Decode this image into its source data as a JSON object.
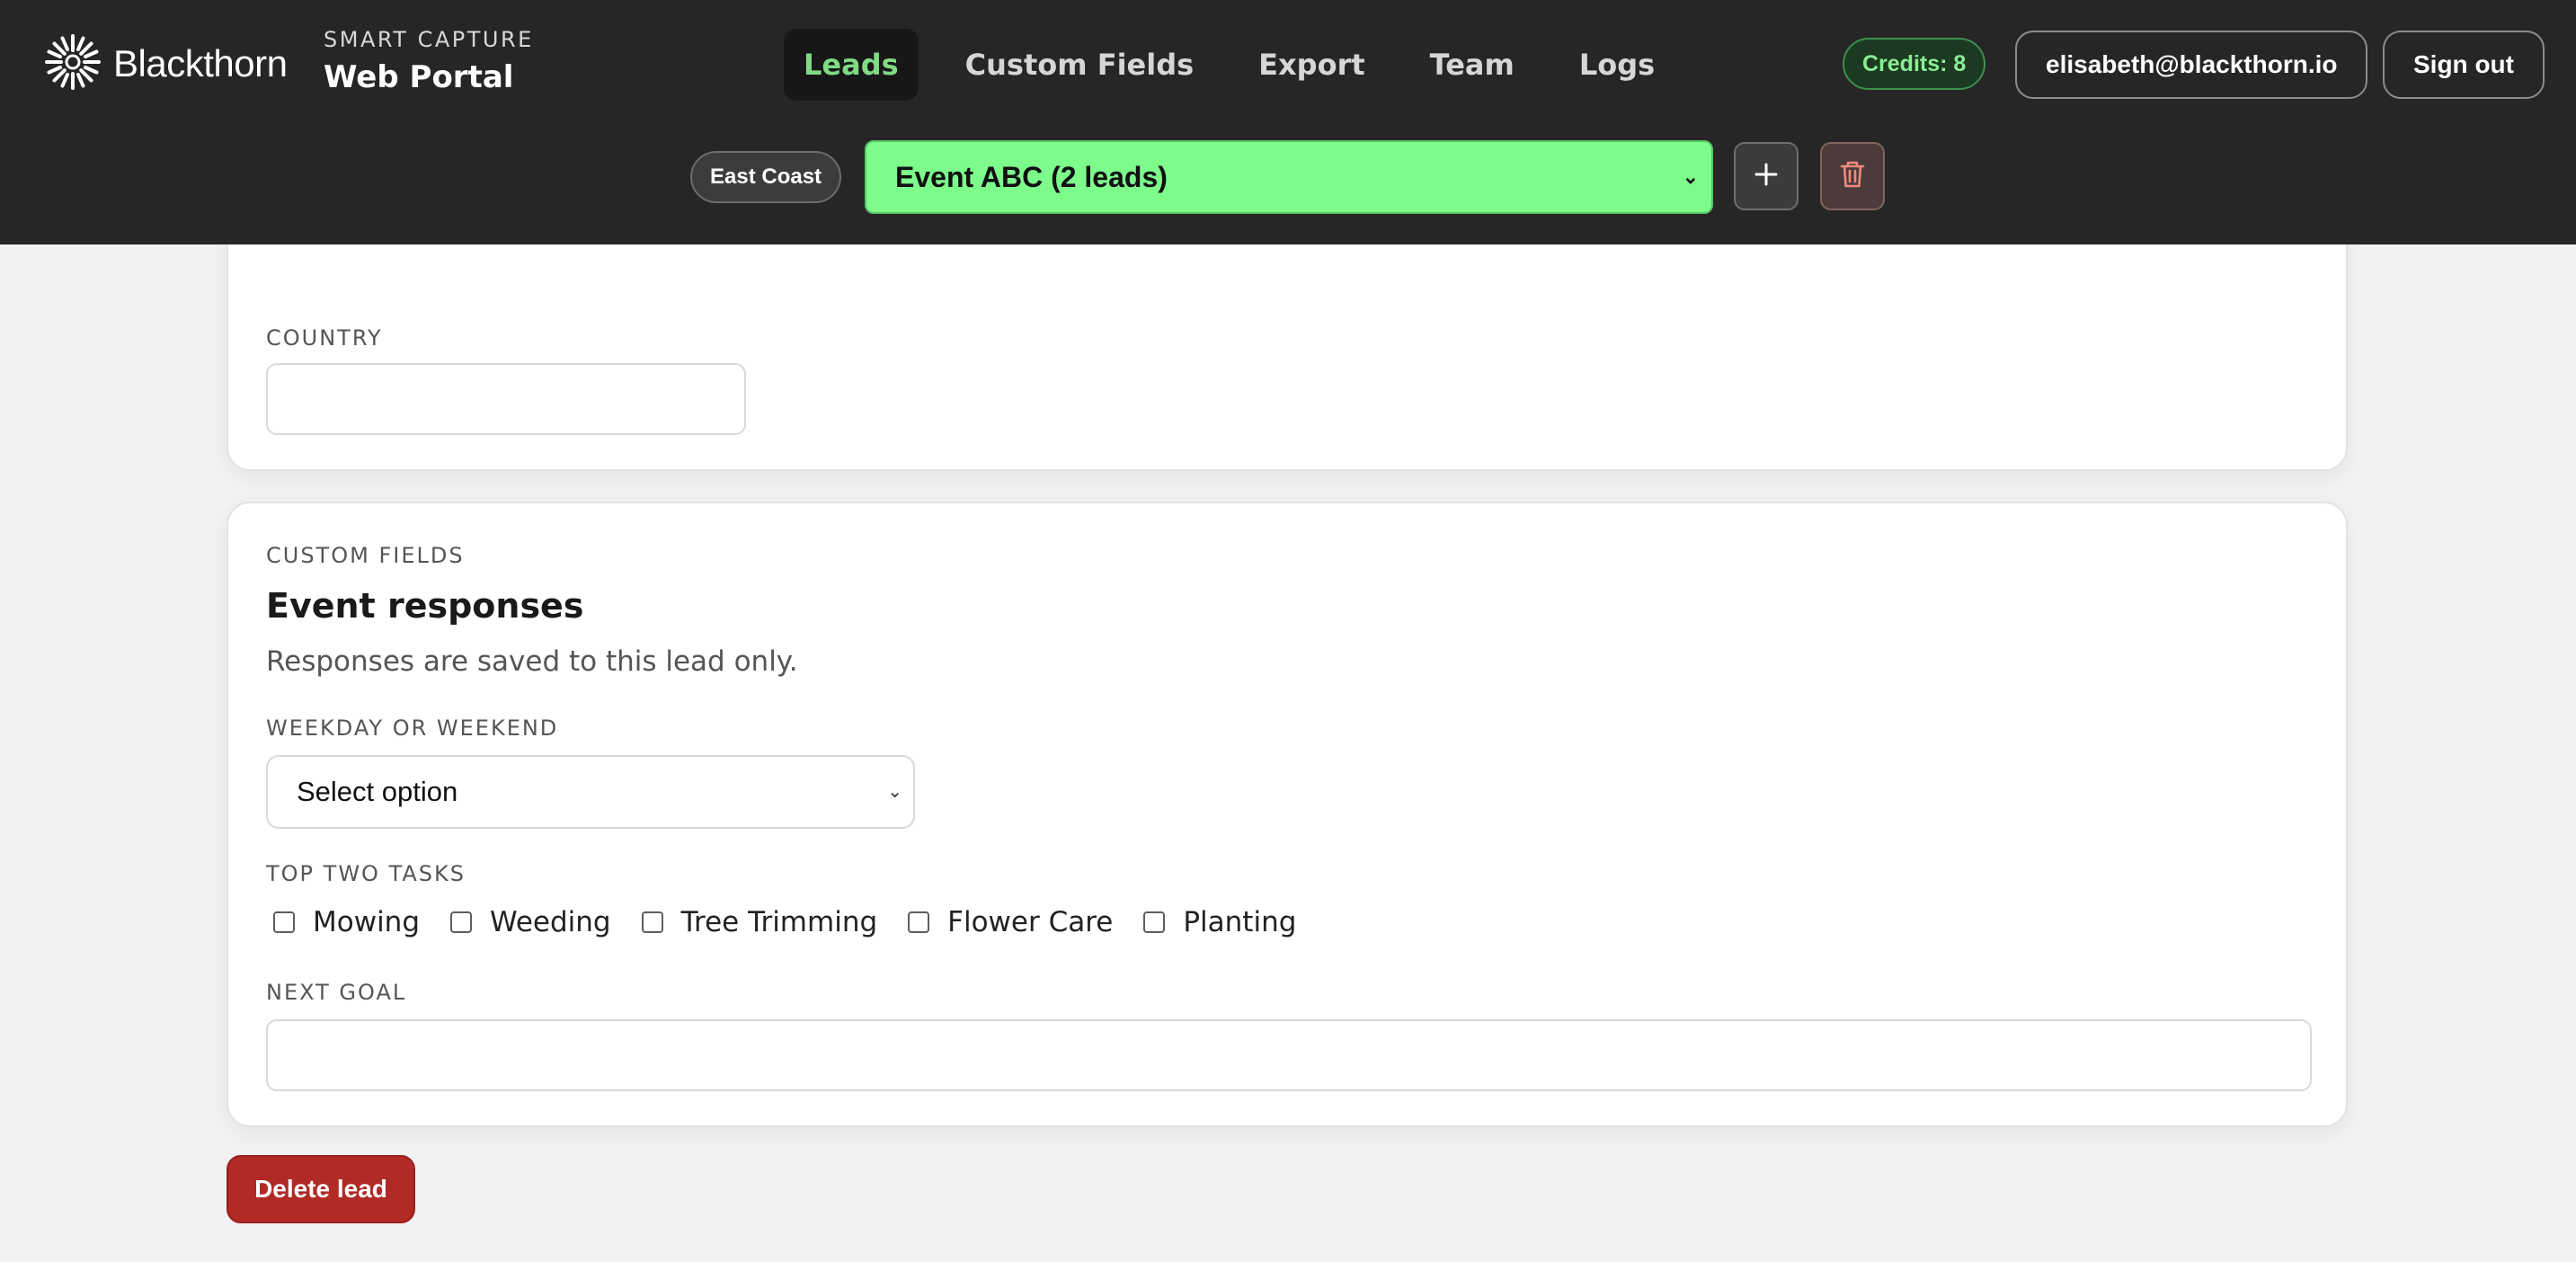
{
  "header": {
    "brand": "Blackthorn",
    "portal_kicker": "SMART CAPTURE",
    "portal_title": "Web Portal",
    "nav": [
      {
        "label": "Leads",
        "active": true
      },
      {
        "label": "Custom Fields",
        "active": false
      },
      {
        "label": "Export",
        "active": false
      },
      {
        "label": "Team",
        "active": false
      },
      {
        "label": "Logs",
        "active": false
      }
    ],
    "credits": "Credits: 8",
    "user_email": "elisabeth@blackthorn.io",
    "sign_out": "Sign out"
  },
  "toolbar": {
    "region": "East Coast",
    "event_selected": "Event ABC (2 leads)",
    "add_icon": "plus-icon",
    "delete_icon": "trash-icon"
  },
  "address_section": {
    "country_label": "COUNTRY",
    "country_value": ""
  },
  "custom_fields": {
    "kicker": "CUSTOM FIELDS",
    "title": "Event responses",
    "subtitle": "Responses are saved to this lead only.",
    "weekday_label": "WEEKDAY OR WEEKEND",
    "weekday_value": "Select option",
    "tasks_label": "TOP TWO TASKS",
    "tasks": [
      {
        "label": "Mowing",
        "checked": false
      },
      {
        "label": "Weeding",
        "checked": false
      },
      {
        "label": "Tree Trimming",
        "checked": false
      },
      {
        "label": "Flower Care",
        "checked": false
      },
      {
        "label": "Planting",
        "checked": false
      }
    ],
    "next_goal_label": "NEXT GOAL",
    "next_goal_value": ""
  },
  "actions": {
    "delete_lead": "Delete lead"
  },
  "colors": {
    "header_bg": "#262626",
    "accent_green": "#7dfc8c",
    "nav_active": "#7fdc84",
    "danger": "#b12a26"
  }
}
